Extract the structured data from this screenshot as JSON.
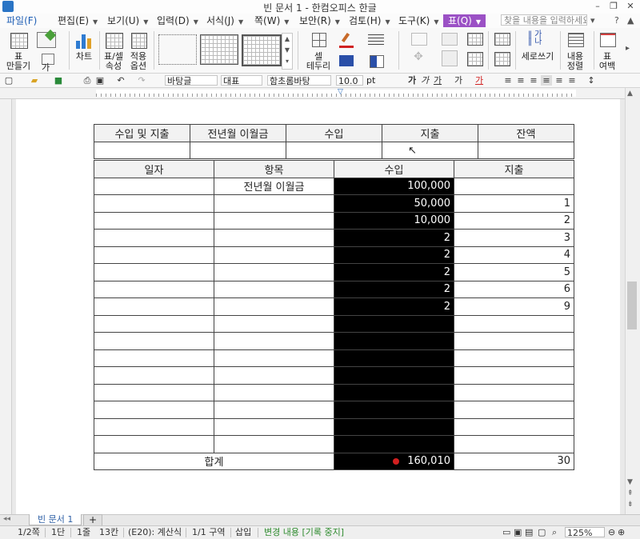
{
  "window": {
    "title": "빈 문서 1 - 한컴오피스 한글",
    "minimize": "–",
    "restore": "❐",
    "close": "✕",
    "mini_extra": "▫"
  },
  "menu": {
    "items": [
      "파일(F)",
      "편집(E)",
      "보기(U)",
      "입력(D)",
      "서식(J)",
      "쪽(W)",
      "보안(R)",
      "검토(H)",
      "도구(K)",
      "표(Q)"
    ],
    "search_placeholder": "찾을 내용을 입력하세요"
  },
  "ribbon": {
    "table_make": [
      "표",
      "만들기"
    ],
    "cell_label": "가",
    "chart": "차트",
    "cell_props": [
      "표/셀",
      "속성"
    ],
    "apply_options": [
      "적용",
      "옵션"
    ],
    "cell_border": [
      "셀",
      "테두리"
    ],
    "vertical_write": "세로쓰기",
    "content_align": [
      "내용",
      "정렬"
    ],
    "table_margin": [
      "표",
      "여백"
    ]
  },
  "format_bar": {
    "style": "바탕글",
    "language": "대표",
    "font": "함초롬바탕",
    "size": "10.0",
    "unit": "pt",
    "bold": "가",
    "italic": "가",
    "underline": "가",
    "strike": "가",
    "color": "가"
  },
  "summary_table": {
    "headers": [
      "수입 및 지출",
      "전년월 이월금",
      "수입",
      "지출",
      "잔액"
    ]
  },
  "ledger": {
    "headers": [
      "일자",
      "항목",
      "수입",
      "지출"
    ],
    "rows": [
      {
        "date": "",
        "item": "전년월 이월금",
        "income": "100,000",
        "expense": ""
      },
      {
        "date": "",
        "item": "",
        "income": "50,000",
        "expense": "1"
      },
      {
        "date": "",
        "item": "",
        "income": "10,000",
        "expense": "2"
      },
      {
        "date": "",
        "item": "",
        "income": "2",
        "expense": "3"
      },
      {
        "date": "",
        "item": "",
        "income": "2",
        "expense": "4"
      },
      {
        "date": "",
        "item": "",
        "income": "2",
        "expense": "5"
      },
      {
        "date": "",
        "item": "",
        "income": "2",
        "expense": "6"
      },
      {
        "date": "",
        "item": "",
        "income": "2",
        "expense": "9"
      },
      {
        "date": "",
        "item": "",
        "income": "",
        "expense": ""
      },
      {
        "date": "",
        "item": "",
        "income": "",
        "expense": ""
      },
      {
        "date": "",
        "item": "",
        "income": "",
        "expense": ""
      },
      {
        "date": "",
        "item": "",
        "income": "",
        "expense": ""
      },
      {
        "date": "",
        "item": "",
        "income": "",
        "expense": ""
      },
      {
        "date": "",
        "item": "",
        "income": "",
        "expense": ""
      },
      {
        "date": "",
        "item": "",
        "income": "",
        "expense": ""
      },
      {
        "date": "",
        "item": "",
        "income": "",
        "expense": ""
      }
    ],
    "total_label": "합계",
    "total_income": "160,010",
    "total_expense": "30"
  },
  "tabs": {
    "document": "빈 문서 1",
    "add": "+"
  },
  "status": {
    "page": "1/2쪽",
    "column": "1단",
    "line": "1줄",
    "position": "13칸",
    "cell": "(E20): 계산식",
    "section": "1/1 구역",
    "mode": "삽입",
    "track": "변경 내용 [기록 중지]",
    "zoom": "125%"
  },
  "colors": {
    "accent_menu": "#9b51c5",
    "dark_cell": "#000000",
    "track_text": "#2e8b2e",
    "tab_text": "#2d5fa5"
  }
}
